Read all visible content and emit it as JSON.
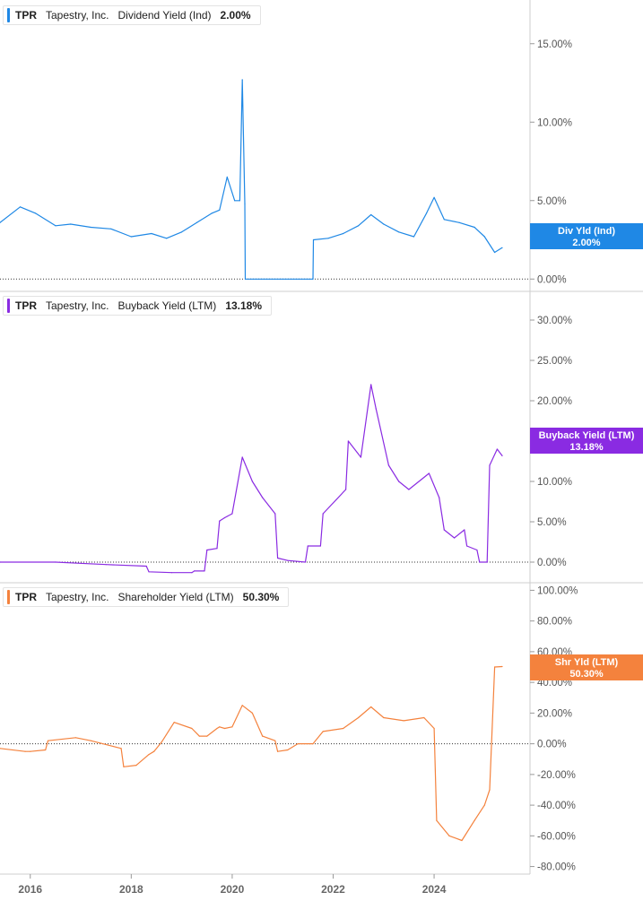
{
  "chart_data": [
    {
      "type": "line",
      "ticker": "TPR",
      "company": "Tapestry, Inc.",
      "metric": "Dividend Yield (Ind)",
      "current_value": "2.00%",
      "tag_label": "Div Yld (Ind)",
      "tag_value": "2.00%",
      "color": "#1f88e5",
      "ylim": [
        -0.5,
        17.5
      ],
      "ticks": [
        0,
        5,
        10,
        15
      ],
      "tick_labels": [
        "0.00%",
        "5.00%",
        "10.00%",
        "15.00%"
      ],
      "x": [
        2015.4,
        2015.8,
        2016.1,
        2016.5,
        2016.8,
        2017.2,
        2017.6,
        2018.0,
        2018.4,
        2018.7,
        2019.0,
        2019.3,
        2019.6,
        2019.75,
        2019.9,
        2020.05,
        2020.15,
        2020.2,
        2020.25,
        2020.26,
        2021.6,
        2021.61,
        2021.9,
        2022.2,
        2022.5,
        2022.75,
        2023.0,
        2023.3,
        2023.6,
        2023.85,
        2024.0,
        2024.2,
        2024.5,
        2024.8,
        2025.0,
        2025.2,
        2025.35
      ],
      "values": [
        3.6,
        4.6,
        4.2,
        3.4,
        3.5,
        3.3,
        3.2,
        2.7,
        2.9,
        2.6,
        3.0,
        3.6,
        4.2,
        4.4,
        6.5,
        5.0,
        5.0,
        12.7,
        4.8,
        0.0,
        0.0,
        2.5,
        2.6,
        2.9,
        3.4,
        4.1,
        3.5,
        3.0,
        2.7,
        4.2,
        5.2,
        3.8,
        3.6,
        3.3,
        2.7,
        1.7,
        2.0
      ]
    },
    {
      "type": "line",
      "ticker": "TPR",
      "company": "Tapestry, Inc.",
      "metric": "Buyback Yield (LTM)",
      "current_value": "13.18%",
      "tag_label": "Buyback Yield (LTM)",
      "tag_value": "13.18%",
      "color": "#8a2be2",
      "ylim": [
        -2,
        33
      ],
      "ticks": [
        0,
        5,
        10,
        15,
        20,
        25,
        30
      ],
      "tick_labels": [
        "0.00%",
        "5.00%",
        "10.00%",
        "15.00%",
        "20.00%",
        "25.00%",
        "30.00%"
      ],
      "x": [
        2015.4,
        2016.5,
        2017.5,
        2018.3,
        2018.35,
        2018.8,
        2019.2,
        2019.25,
        2019.45,
        2019.5,
        2019.7,
        2019.75,
        2019.85,
        2020.0,
        2020.2,
        2020.4,
        2020.6,
        2020.85,
        2020.9,
        2021.1,
        2021.45,
        2021.5,
        2021.75,
        2021.8,
        2022.25,
        2022.3,
        2022.55,
        2022.75,
        2022.85,
        2023.1,
        2023.3,
        2023.5,
        2023.9,
        2024.1,
        2024.2,
        2024.4,
        2024.6,
        2024.65,
        2024.85,
        2024.9,
        2025.05,
        2025.1,
        2025.25,
        2025.35
      ],
      "values": [
        0.0,
        0.0,
        -0.3,
        -0.5,
        -1.2,
        -1.3,
        -1.3,
        -1.1,
        -1.1,
        1.5,
        1.7,
        5.1,
        5.5,
        6.0,
        13.0,
        10.0,
        8.0,
        6.0,
        0.5,
        0.2,
        0.0,
        2.0,
        2.0,
        6.0,
        9.0,
        15.0,
        13.0,
        22.0,
        19.0,
        12.0,
        10.0,
        9.0,
        11.0,
        8.0,
        4.0,
        3.0,
        4.0,
        2.0,
        1.5,
        0.0,
        0.0,
        12.0,
        14.0,
        13.18
      ]
    },
    {
      "type": "line",
      "ticker": "TPR",
      "company": "Tapestry, Inc.",
      "metric": "Shareholder Yield (LTM)",
      "current_value": "50.30%",
      "tag_label": "Shr Yld (LTM)",
      "tag_value": "50.30%",
      "color": "#f4823d",
      "ylim": [
        -82,
        102
      ],
      "ticks": [
        -80,
        -60,
        -40,
        -20,
        0,
        20,
        40,
        60,
        80,
        100
      ],
      "tick_labels": [
        "-80.00%",
        "-60.00%",
        "-40.00%",
        "-20.00%",
        "0.00%",
        "20.00%",
        "40.00%",
        "60.00%",
        "80.00%",
        "100.00%"
      ],
      "x": [
        2015.4,
        2015.9,
        2016.0,
        2016.3,
        2016.35,
        2016.9,
        2017.2,
        2017.8,
        2017.85,
        2018.1,
        2018.35,
        2018.45,
        2018.6,
        2018.85,
        2019.2,
        2019.35,
        2019.5,
        2019.7,
        2019.75,
        2019.85,
        2020.0,
        2020.2,
        2020.4,
        2020.6,
        2020.85,
        2020.9,
        2021.1,
        2021.3,
        2021.6,
        2021.8,
        2022.2,
        2022.5,
        2022.75,
        2023.0,
        2023.4,
        2023.8,
        2024.0,
        2024.05,
        2024.3,
        2024.55,
        2024.8,
        2025.0,
        2025.1,
        2025.2,
        2025.35
      ],
      "values": [
        -3.0,
        -5.0,
        -5.0,
        -4.0,
        2.0,
        4.0,
        2.0,
        -3.0,
        -15.0,
        -14.0,
        -7.0,
        -5.0,
        1.0,
        14.0,
        10.0,
        5.0,
        5.0,
        10.0,
        11.0,
        10.0,
        11.0,
        25.0,
        20.0,
        5.0,
        2.0,
        -5.0,
        -4.0,
        0.0,
        0.0,
        8.0,
        10.0,
        17.0,
        24.0,
        17.0,
        15.0,
        17.0,
        10.0,
        -50.0,
        -60.0,
        -63.0,
        -50.0,
        -40.0,
        -30.0,
        50.0,
        50.3
      ]
    }
  ],
  "x_axis": {
    "xlim": [
      2015.4,
      2025.9
    ],
    "ticks": [
      2016,
      2018,
      2020,
      2022,
      2024
    ],
    "tick_labels": [
      "2016",
      "2018",
      "2020",
      "2022",
      "2024"
    ]
  }
}
